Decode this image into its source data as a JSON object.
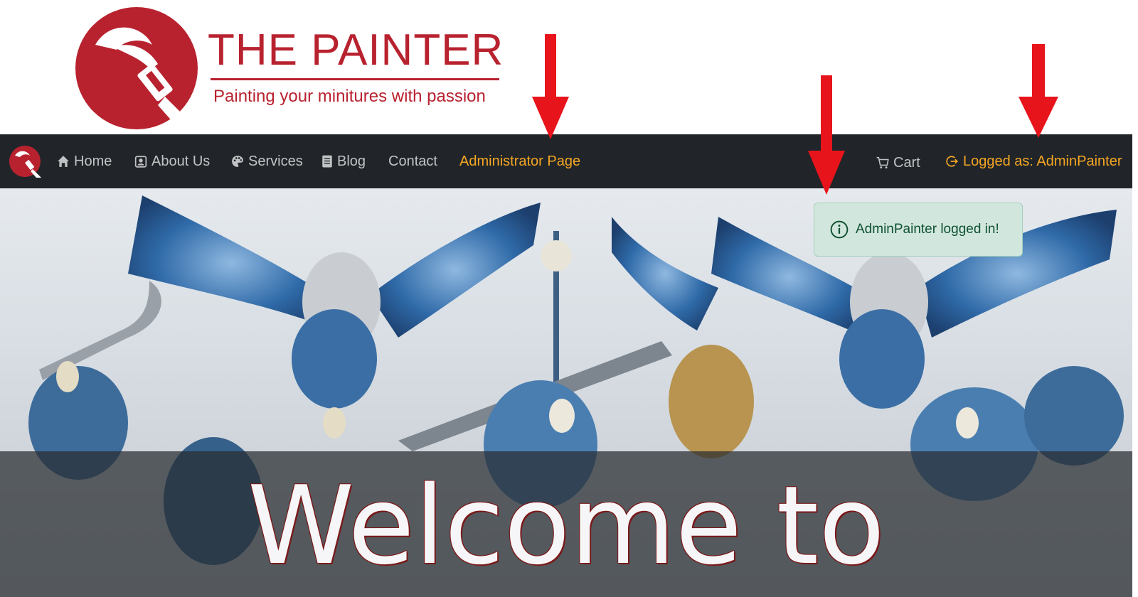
{
  "brand": {
    "title": "THE PAINTER",
    "tagline": "Painting your minitures with passion",
    "color": "#b8222f"
  },
  "navbar": {
    "background": "#212529",
    "accent": "#f5a623",
    "items": [
      {
        "label": "Home",
        "icon": "home-icon"
      },
      {
        "label": "About Us",
        "icon": "person-badge-icon"
      },
      {
        "label": "Services",
        "icon": "palette-icon"
      },
      {
        "label": "Blog",
        "icon": "document-icon"
      },
      {
        "label": "Contact",
        "icon": ""
      },
      {
        "label": "Administrator Page",
        "icon": ""
      }
    ],
    "cart": {
      "label": "Cart",
      "icon": "cart-icon"
    },
    "user": {
      "label": "Logged as: AdminPainter",
      "icon": "logout-icon"
    }
  },
  "toast": {
    "message": "AdminPainter logged in!",
    "icon": "info-icon",
    "background": "#d1e7dd"
  },
  "hero": {
    "title": "Welcome to"
  },
  "annotations": {
    "arrow_color": "#e8141b"
  }
}
